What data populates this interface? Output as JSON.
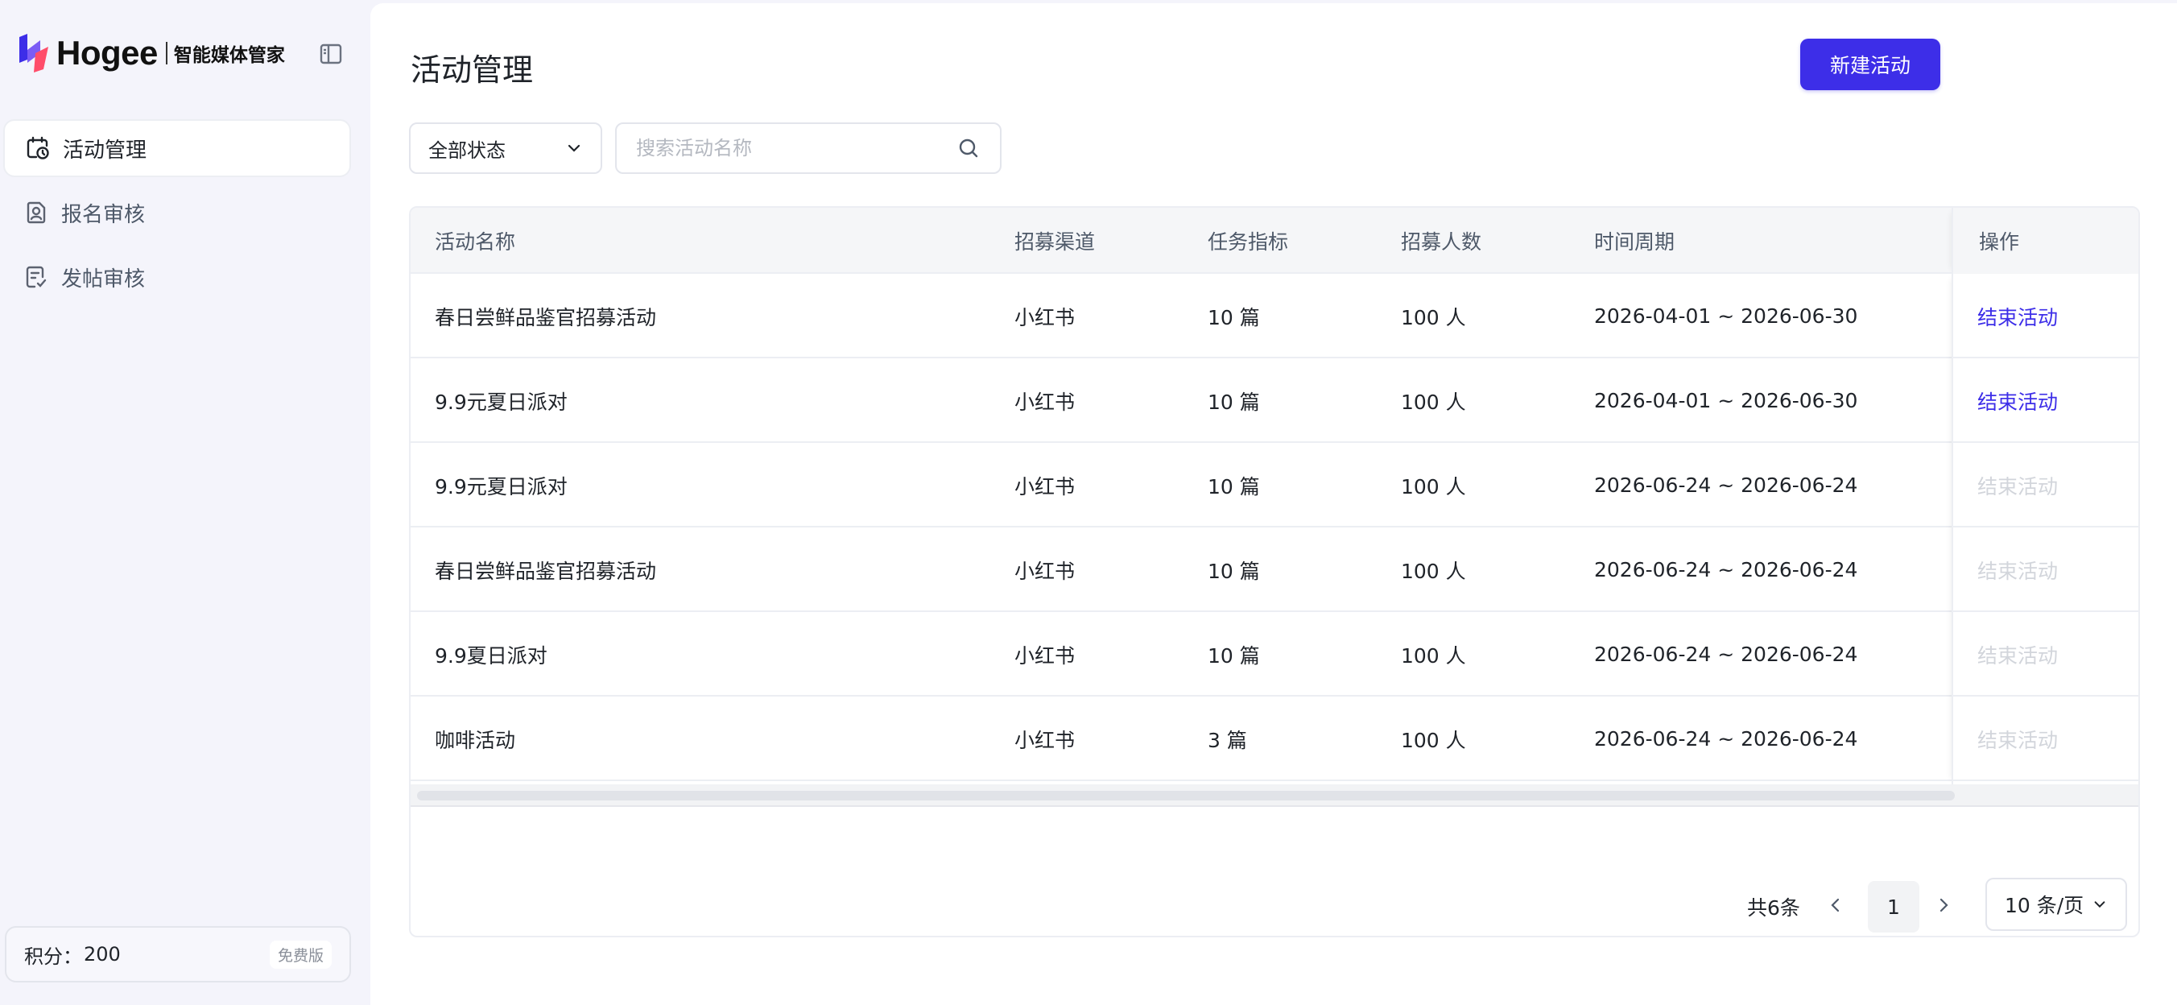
{
  "brand": {
    "name": "Hogee",
    "subtitle": "智能媒体管家"
  },
  "sidebar": {
    "items": [
      {
        "label": "活动管理",
        "icon": "calendar-clock-icon",
        "active": true
      },
      {
        "label": "报名审核",
        "icon": "user-document-icon",
        "active": false
      },
      {
        "label": "发帖审核",
        "icon": "post-check-icon",
        "active": false
      }
    ],
    "points_label": "积分：",
    "points_value": "200",
    "plan": "免费版"
  },
  "header": {
    "title": "活动管理",
    "new_button": "新建活动"
  },
  "filters": {
    "status_value": "全部状态",
    "search_placeholder": "搜索活动名称"
  },
  "table": {
    "columns": [
      "活动名称",
      "招募渠道",
      "任务指标",
      "招募人数",
      "时间周期",
      "操作"
    ],
    "rows": [
      {
        "name": "春日尝鲜品鉴官招募活动",
        "channel": "小红书",
        "target": "10 篇",
        "people": "100 人",
        "period": "2026-04-01 ~ 2026-06-30",
        "action": "结束活动",
        "enabled": true
      },
      {
        "name": "9.9元夏日派对",
        "channel": "小红书",
        "target": "10 篇",
        "people": "100 人",
        "period": "2026-04-01 ~ 2026-06-30",
        "action": "结束活动",
        "enabled": true
      },
      {
        "name": "9.9元夏日派对",
        "channel": "小红书",
        "target": "10 篇",
        "people": "100 人",
        "period": "2026-06-24 ~ 2026-06-24",
        "action": "结束活动",
        "enabled": false
      },
      {
        "name": "春日尝鲜品鉴官招募活动",
        "channel": "小红书",
        "target": "10 篇",
        "people": "100 人",
        "period": "2026-06-24 ~ 2026-06-24",
        "action": "结束活动",
        "enabled": false
      },
      {
        "name": "9.9夏日派对",
        "channel": "小红书",
        "target": "10 篇",
        "people": "100 人",
        "period": "2026-06-24 ~ 2026-06-24",
        "action": "结束活动",
        "enabled": false
      },
      {
        "name": "咖啡活动",
        "channel": "小红书",
        "target": "3 篇",
        "people": "100 人",
        "period": "2026-06-24 ~ 2026-06-24",
        "action": "结束活动",
        "enabled": false
      }
    ]
  },
  "pagination": {
    "total": "共6条",
    "current_page": "1",
    "page_size": "10 条/页"
  },
  "colors": {
    "primary": "#3d2ee8",
    "disabled_link": "#d2d5db"
  }
}
